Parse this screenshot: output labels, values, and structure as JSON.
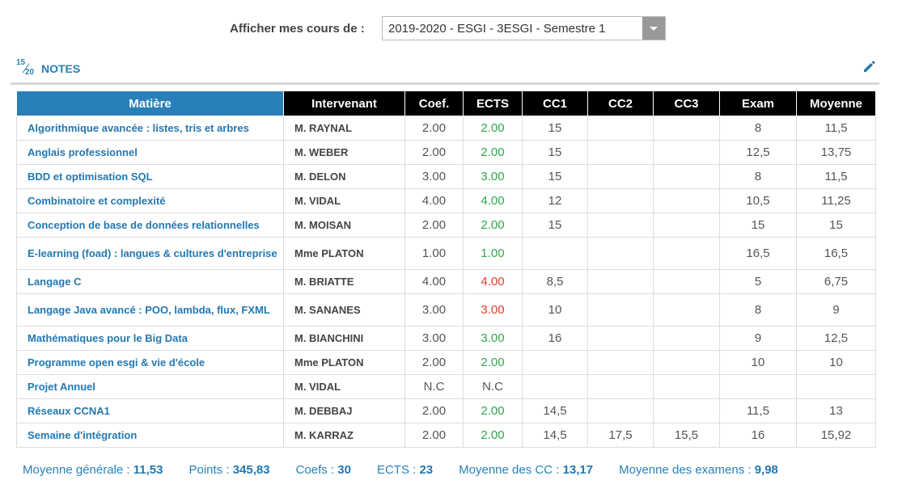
{
  "filter": {
    "label": "Afficher mes cours de :",
    "selected": "2019-2020 - ESGI - 3ESGI - Semestre 1"
  },
  "header": {
    "icon_numerator": "15",
    "icon_denominator": "20",
    "title": "NOTES",
    "edit_icon": "pencil-icon"
  },
  "table": {
    "columns": [
      "Matière",
      "Intervenant",
      "Coef.",
      "ECTS",
      "CC1",
      "CC2",
      "CC3",
      "Exam",
      "Moyenne"
    ],
    "rows": [
      {
        "subject": "Algorithmique avancée : listes, tris et arbres",
        "teacher": "M. RAYNAL",
        "coef": "2.00",
        "ects": "2.00",
        "ects_status": "green",
        "cc1": "15",
        "cc2": "",
        "cc3": "",
        "exam": "8",
        "avg": "11,5"
      },
      {
        "subject": "Anglais professionnel",
        "teacher": "M. WEBER",
        "coef": "2.00",
        "ects": "2.00",
        "ects_status": "green",
        "cc1": "15",
        "cc2": "",
        "cc3": "",
        "exam": "12,5",
        "avg": "13,75"
      },
      {
        "subject": "BDD et optimisation SQL",
        "teacher": "M. DELON",
        "coef": "3.00",
        "ects": "3.00",
        "ects_status": "green",
        "cc1": "15",
        "cc2": "",
        "cc3": "",
        "exam": "8",
        "avg": "11,5"
      },
      {
        "subject": "Combinatoire et complexité",
        "teacher": "M. VIDAL",
        "coef": "4.00",
        "ects": "4.00",
        "ects_status": "green",
        "cc1": "12",
        "cc2": "",
        "cc3": "",
        "exam": "10,5",
        "avg": "11,25"
      },
      {
        "subject": "Conception de base de données relationnelles",
        "teacher": "M. MOISAN",
        "coef": "2.00",
        "ects": "2.00",
        "ects_status": "green",
        "cc1": "15",
        "cc2": "",
        "cc3": "",
        "exam": "15",
        "avg": "15"
      },
      {
        "subject": "E-learning (foad) : langues & cultures d'entreprise",
        "teacher": "Mme PLATON",
        "coef": "1.00",
        "ects": "1.00",
        "ects_status": "green",
        "cc1": "",
        "cc2": "",
        "cc3": "",
        "exam": "16,5",
        "avg": "16,5",
        "tall": true
      },
      {
        "subject": "Langage C",
        "teacher": "M. BRIATTE",
        "coef": "4.00",
        "ects": "4.00",
        "ects_status": "red",
        "cc1": "8,5",
        "cc2": "",
        "cc3": "",
        "exam": "5",
        "avg": "6,75"
      },
      {
        "subject": "Langage Java avancé : POO, lambda, flux, FXML",
        "teacher": "M. SANANES",
        "coef": "3.00",
        "ects": "3.00",
        "ects_status": "red",
        "cc1": "10",
        "cc2": "",
        "cc3": "",
        "exam": "8",
        "avg": "9",
        "tall": true
      },
      {
        "subject": "Mathématiques pour le Big Data",
        "teacher": "M. BIANCHINI",
        "coef": "3.00",
        "ects": "3.00",
        "ects_status": "green",
        "cc1": "16",
        "cc2": "",
        "cc3": "",
        "exam": "9",
        "avg": "12,5"
      },
      {
        "subject": "Programme open esgi & vie d'école",
        "teacher": "Mme PLATON",
        "coef": "2.00",
        "ects": "2.00",
        "ects_status": "green",
        "cc1": "",
        "cc2": "",
        "cc3": "",
        "exam": "10",
        "avg": "10"
      },
      {
        "subject": "Projet Annuel",
        "teacher": "M. VIDAL",
        "coef": "N.C",
        "ects": "N.C",
        "ects_status": "plain",
        "cc1": "",
        "cc2": "",
        "cc3": "",
        "exam": "",
        "avg": ""
      },
      {
        "subject": "Réseaux CCNA1",
        "teacher": "M. DEBBAJ",
        "coef": "2.00",
        "ects": "2.00",
        "ects_status": "green",
        "cc1": "14,5",
        "cc2": "",
        "cc3": "",
        "exam": "11,5",
        "avg": "13"
      },
      {
        "subject": "Semaine d'intégration",
        "teacher": "M. KARRAZ",
        "coef": "2.00",
        "ects": "2.00",
        "ects_status": "green",
        "cc1": "14,5",
        "cc2": "17,5",
        "cc3": "15,5",
        "exam": "16",
        "avg": "15,92"
      }
    ]
  },
  "colors": {
    "accent": "#2980b9",
    "ects_green": "#2ea84a",
    "ects_red": "#e03b2c",
    "header_black": "#000000"
  },
  "summary": [
    {
      "label": "Moyenne générale : ",
      "value": "11,53"
    },
    {
      "label": "Points : ",
      "value": "345,83"
    },
    {
      "label": "Coefs : ",
      "value": "30"
    },
    {
      "label": "ECTS : ",
      "value": "23"
    },
    {
      "label": "Moyenne des CC : ",
      "value": "13,17"
    },
    {
      "label": "Moyenne des examens : ",
      "value": "9,98"
    }
  ]
}
